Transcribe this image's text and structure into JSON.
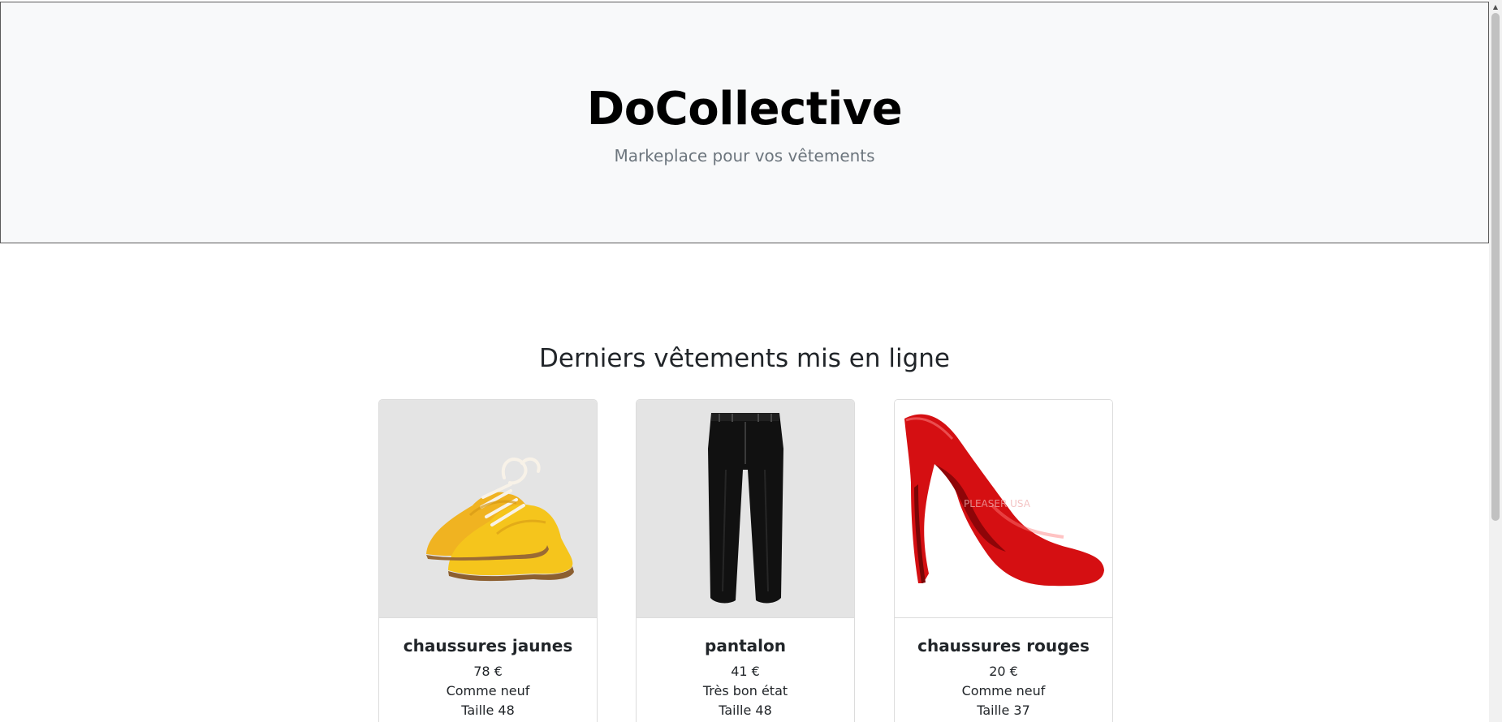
{
  "hero": {
    "title": "DoCollective",
    "subtitle": "Markeplace pour vos vêtements"
  },
  "section": {
    "title": "Derniers vêtements mis en ligne"
  },
  "products": [
    {
      "title": "chaussures jaunes",
      "price": "78 €",
      "condition": "Comme neuf",
      "size": "Taille 48",
      "image_icon": "yellow-shoes-image",
      "color": "#f0b321"
    },
    {
      "title": "pantalon",
      "price": "41 €",
      "condition": "Très bon état",
      "size": "Taille 48",
      "image_icon": "black-pants-image",
      "color": "#111111"
    },
    {
      "title": "chaussures rouges",
      "price": "20 €",
      "condition": "Comme neuf",
      "size": "Taille 37",
      "image_icon": "red-heel-image",
      "color": "#d50f12",
      "watermark": "PLEASER USA"
    }
  ],
  "scrollbar": {
    "up_arrow": "▲",
    "position": 0.0
  }
}
